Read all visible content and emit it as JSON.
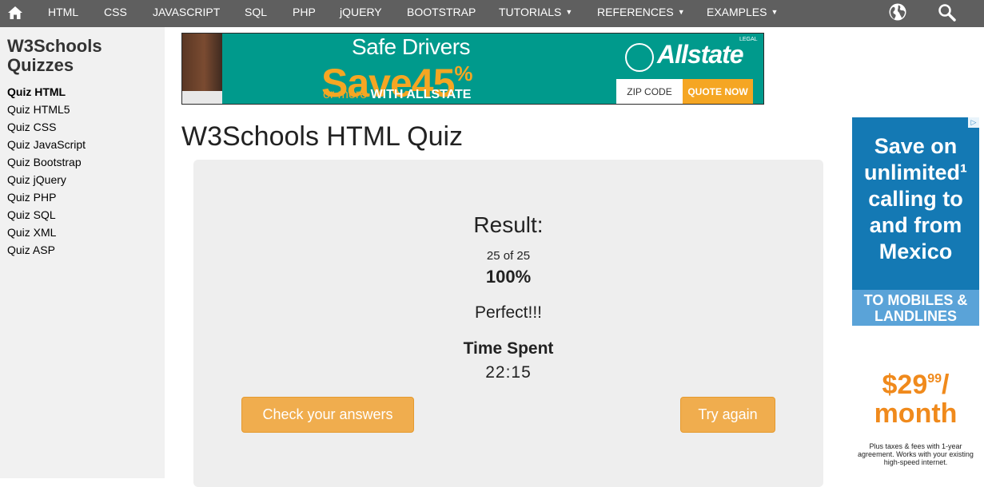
{
  "nav": {
    "items": [
      "HTML",
      "CSS",
      "JAVASCRIPT",
      "SQL",
      "PHP",
      "jQUERY",
      "BOOTSTRAP",
      "TUTORIALS",
      "REFERENCES",
      "EXAMPLES"
    ],
    "dropdown_items": [
      "TUTORIALS",
      "REFERENCES",
      "EXAMPLES"
    ],
    "bg_color": "#5f5f5f"
  },
  "sidebar": {
    "title": "W3Schools Quizzes",
    "links": [
      "Quiz HTML",
      "Quiz HTML5",
      "Quiz CSS",
      "Quiz JavaScript",
      "Quiz Bootstrap",
      "Quiz jQuery",
      "Quiz PHP",
      "Quiz SQL",
      "Quiz XML",
      "Quiz ASP"
    ],
    "active": "Quiz HTML"
  },
  "banner_ad": {
    "line1": "Safe Drivers",
    "line2": "Save",
    "percent": "45",
    "percent_sign": "%",
    "line3_a": "or more",
    "line3_b": "WITH ALLSTATE",
    "brand": "Allstate",
    "legal": "LEGAL",
    "zip_placeholder": "ZIP CODE",
    "quote_button": "QUOTE NOW"
  },
  "page": {
    "title": "W3Schools HTML Quiz"
  },
  "result": {
    "title": "Result:",
    "count": "25 of 25",
    "percent": "100%",
    "message": "Perfect!!!",
    "time_label": "Time Spent",
    "time_value": "22:15",
    "check_button": "Check your answers",
    "again_button": "Try again",
    "button_color": "#f0ad4e"
  },
  "side_ad": {
    "headline": "Save on unlimited¹ calling to and from Mexico",
    "band": "TO MOBILES & LANDLINES",
    "price_dollars": "$29",
    "price_cents": "99",
    "price_unit": "/ month",
    "fine_print": "Plus taxes & fees with 1-year agreement. Works with your existing high-speed internet."
  }
}
